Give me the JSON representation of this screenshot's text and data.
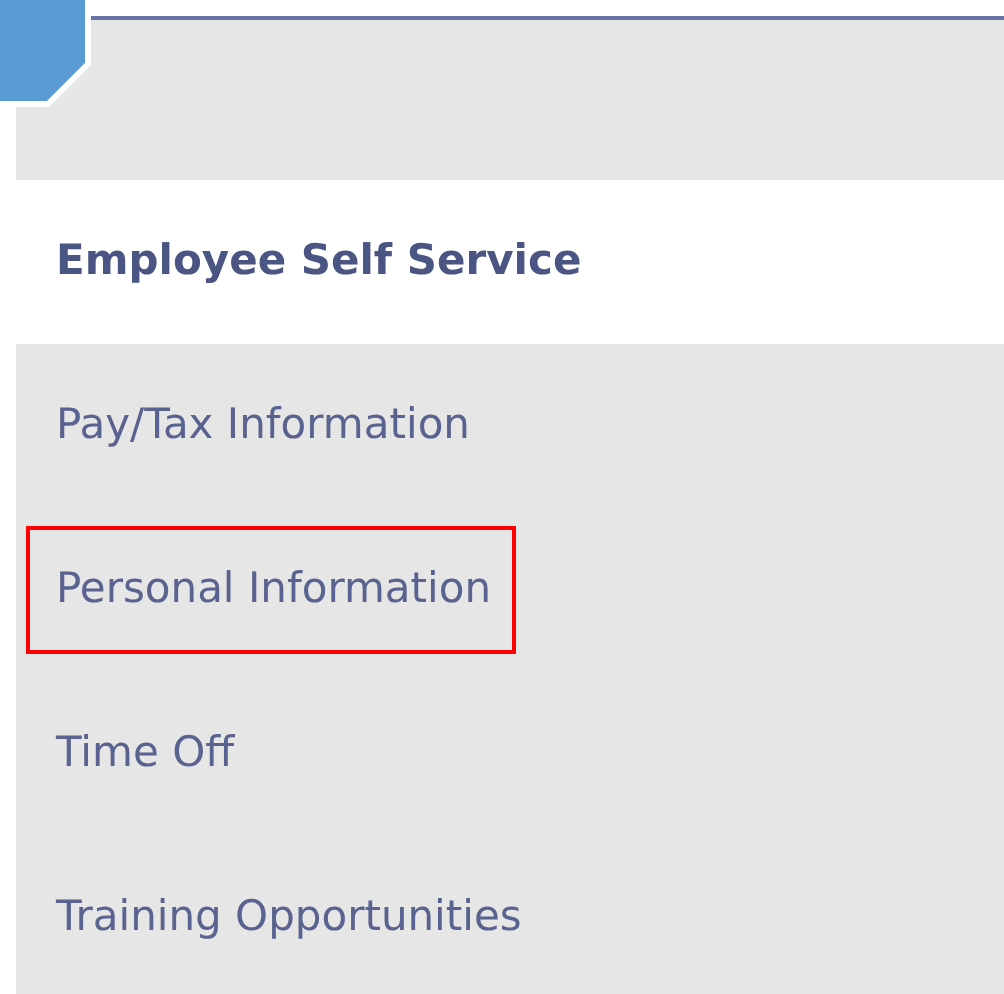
{
  "menu": {
    "heading": "Employee Self Service",
    "items": [
      {
        "label": "Pay/Tax Information",
        "highlighted": false
      },
      {
        "label": "Personal Information",
        "highlighted": true
      },
      {
        "label": "Time Off",
        "highlighted": false
      },
      {
        "label": "Training Opportunities",
        "highlighted": false
      }
    ]
  }
}
